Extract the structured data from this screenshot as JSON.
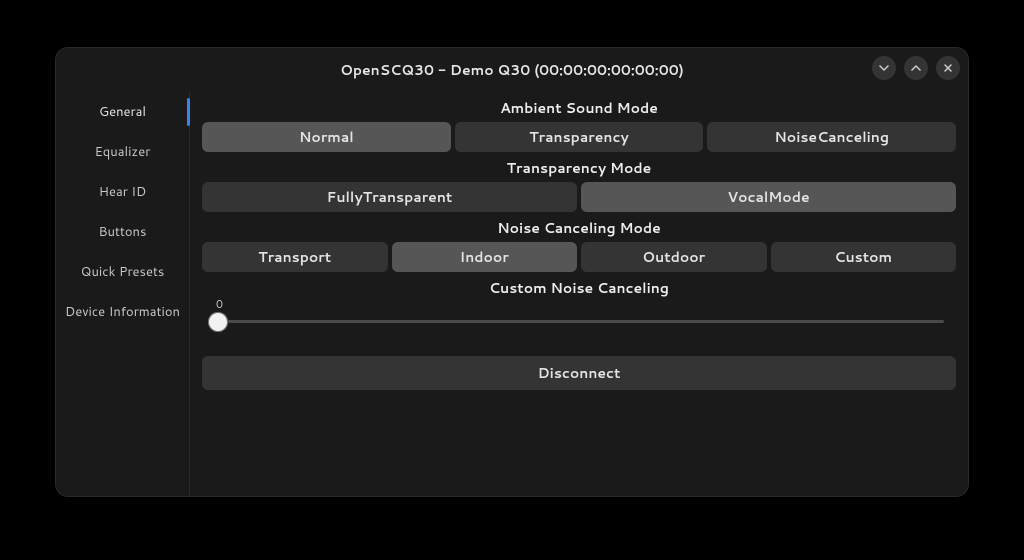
{
  "window": {
    "title": "OpenSCQ30 - Demo Q30 (00:00:00:00:00:00)"
  },
  "sidebar": {
    "items": [
      {
        "label": "General",
        "active": true
      },
      {
        "label": "Equalizer",
        "active": false
      },
      {
        "label": "Hear ID",
        "active": false
      },
      {
        "label": "Buttons",
        "active": false
      },
      {
        "label": "Quick Presets",
        "active": false
      },
      {
        "label": "Device Information",
        "active": false
      }
    ]
  },
  "sections": {
    "ambient": {
      "label": "Ambient Sound Mode",
      "options": [
        {
          "label": "Normal",
          "selected": true
        },
        {
          "label": "Transparency",
          "selected": false
        },
        {
          "label": "NoiseCanceling",
          "selected": false
        }
      ]
    },
    "transparency": {
      "label": "Transparency Mode",
      "options": [
        {
          "label": "FullyTransparent",
          "selected": false
        },
        {
          "label": "VocalMode",
          "selected": true
        }
      ]
    },
    "noise_canceling": {
      "label": "Noise Canceling Mode",
      "options": [
        {
          "label": "Transport",
          "selected": false
        },
        {
          "label": "Indoor",
          "selected": true
        },
        {
          "label": "Outdoor",
          "selected": false
        },
        {
          "label": "Custom",
          "selected": false
        }
      ]
    },
    "custom_nc": {
      "label": "Custom Noise Canceling",
      "value": 0,
      "value_label": "0"
    }
  },
  "disconnect": {
    "label": "Disconnect"
  }
}
